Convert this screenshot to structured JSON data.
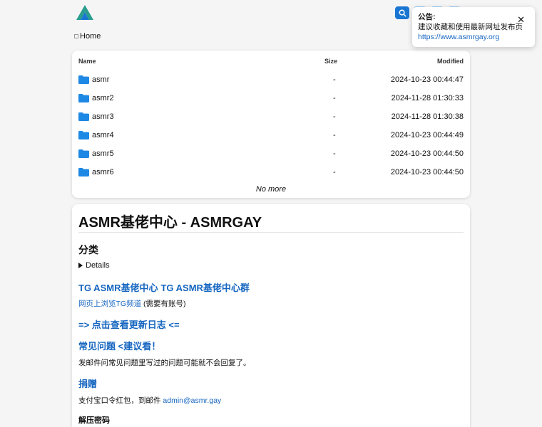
{
  "breadcrumb": {
    "home_label": "Home"
  },
  "file_table": {
    "headers": {
      "name": "Name",
      "size": "Size",
      "modified": "Modified"
    },
    "rows": [
      {
        "name": "asmr",
        "size": "-",
        "modified": "2024-10-23 00:44:47"
      },
      {
        "name": "asmr2",
        "size": "-",
        "modified": "2024-11-28 01:30:33"
      },
      {
        "name": "asmr3",
        "size": "-",
        "modified": "2024-11-28 01:30:38"
      },
      {
        "name": "asmr4",
        "size": "-",
        "modified": "2024-10-23 00:44:49"
      },
      {
        "name": "asmr5",
        "size": "-",
        "modified": "2024-10-23 00:44:50"
      },
      {
        "name": "asmr6",
        "size": "-",
        "modified": "2024-10-23 00:44:50"
      }
    ],
    "no_more": "No more"
  },
  "readme": {
    "title": "ASMR基佬中心 - ASMRGAY",
    "category_heading": "分类",
    "details_label": "Details",
    "tg_link1": "TG ASMR基佬中心",
    "tg_link2": "TG ASMR基佬中心群",
    "web_tg_link": "网页上浏览TG频道",
    "web_tg_note": " (需要有账号)",
    "changelog_link": "=> 点击查看更新日志 <=",
    "faq_heading": "常见问题 <建议看！",
    "faq_note": "发邮件问常见问题里写过的问题可能就不会回复了。",
    "donate_heading": "捐赠",
    "donate_text": "支付宝口令红包，到邮件 ",
    "donate_email": "admin@asmr.gay",
    "password_heading": "解压密码"
  },
  "notice": {
    "title": "公告:",
    "text": "建议收藏和使用最新网址发布页",
    "url": "https://www.asmrgay.org",
    "close": "✕"
  },
  "colors": {
    "accent": "#1976d2",
    "link": "#1565c0",
    "folder": "#1e88e5",
    "logo_teal": "#2a9d8f"
  },
  "icons": [
    "app-logo-icon",
    "search-icon",
    "folder-icon",
    "close-icon",
    "home-icon"
  ]
}
